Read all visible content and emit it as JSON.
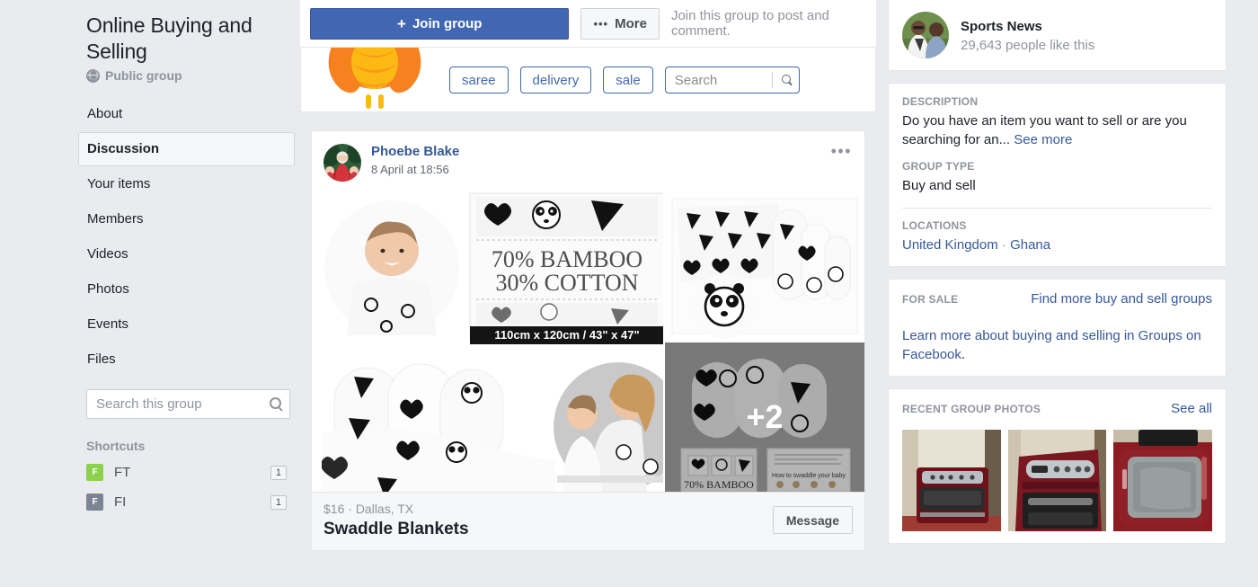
{
  "sidebar": {
    "group_name": "Online Buying and Selling",
    "privacy": "Public group",
    "privacy_icon": "globe-icon",
    "nav": [
      {
        "label": "About",
        "active": false
      },
      {
        "label": "Discussion",
        "active": true
      },
      {
        "label": "Your items",
        "active": false
      },
      {
        "label": "Members",
        "active": false
      },
      {
        "label": "Videos",
        "active": false
      },
      {
        "label": "Photos",
        "active": false
      },
      {
        "label": "Events",
        "active": false
      },
      {
        "label": "Files",
        "active": false
      }
    ],
    "search_placeholder": "Search this group",
    "search_value": "",
    "search_icon": "search-icon",
    "shortcuts_label": "Shortcuts",
    "shortcuts": [
      {
        "badge": "F",
        "label": "FT",
        "count": "1",
        "color": "#8bd14c"
      },
      {
        "badge": "F",
        "label": "FI",
        "count": "1",
        "color": "#7c8494"
      }
    ]
  },
  "action_bar": {
    "join_label": "Join group",
    "join_icon": "plus-icon",
    "more_label": "More",
    "more_icon": "ellipsis-icon",
    "hint": "Join this group to post and comment.",
    "join_color": "#4267b2"
  },
  "cover": {
    "image_name": "owl-mascot-cover",
    "tags": [
      "saree",
      "delivery",
      "sale"
    ],
    "search_placeholder": "Search",
    "search_value": "",
    "search_icon": "search-icon",
    "accent_color": "#4267b2"
  },
  "post": {
    "author": "Phoebe Blake",
    "timestamp": "8 April at 18:56",
    "avatar_name": "santa-with-children-avatar",
    "menu_icon": "ellipsis-icon",
    "media": {
      "main_alt": "baby-swaddle-blanket-collage",
      "package_line1": "70% BAMBOO",
      "package_line2": "30% COTTON",
      "package_size": "110cm x 120cm / 43\" x 47\"",
      "side_top_alt": "folded-swaddle-blankets-panda-print",
      "side_bottom_alt": "rolled-swaddle-blankets",
      "more_count": "+2"
    },
    "listing_price": "$16",
    "listing_separator": "·",
    "listing_location": "Dallas, TX",
    "listing_title": "Swaddle Blankets",
    "message_label": "Message"
  },
  "right": {
    "promo": {
      "name": "Sports News",
      "likes": "29,643 people like this",
      "avatar_name": "sports-news-page-avatar"
    },
    "description": {
      "label": "DESCRIPTION",
      "text": "Do you have an item you want to sell or are you searching for an...",
      "see_more": "See more"
    },
    "group_type": {
      "label": "GROUP TYPE",
      "value": "Buy and sell"
    },
    "locations": {
      "label": "LOCATIONS",
      "items": [
        "United Kingdom",
        "Ghana"
      ],
      "separator": "·"
    },
    "for_sale": {
      "label": "FOR SALE",
      "find_more": "Find more buy and sell groups",
      "learn_more": "Learn more about buying and selling in Groups on Facebook",
      "period": "."
    },
    "recent_photos": {
      "label": "RECENT GROUP PHOTOS",
      "see_all": "See all",
      "items": [
        {
          "alt": "red-washing-machine-photo-1"
        },
        {
          "alt": "red-washing-machine-photo-2"
        },
        {
          "alt": "red-washing-machine-photo-3"
        }
      ]
    }
  }
}
